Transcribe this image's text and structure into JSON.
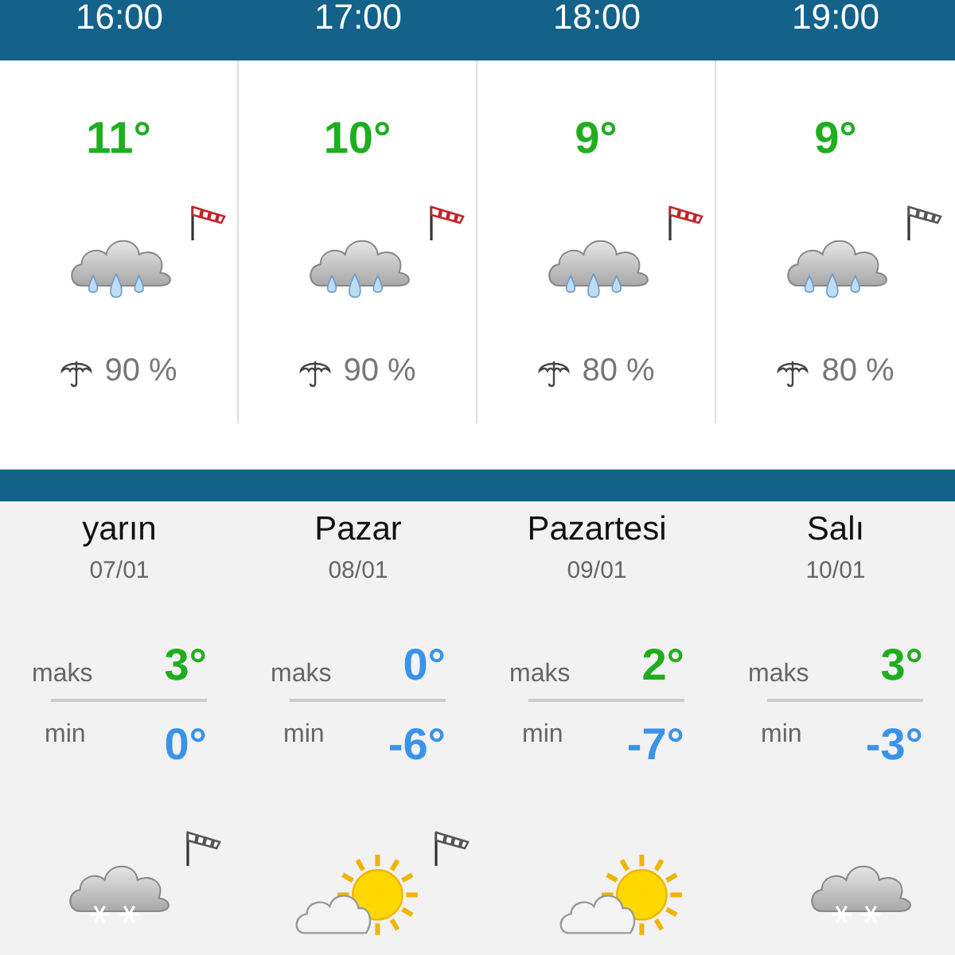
{
  "hourly": [
    {
      "time": "16:00",
      "temp": {
        "text": "11°",
        "color": "#1fae1f"
      },
      "kind": "rain",
      "windsock": {
        "color": "#c0262a"
      },
      "rain_chance": "90 %"
    },
    {
      "time": "17:00",
      "temp": {
        "text": "10°",
        "color": "#1fae1f"
      },
      "kind": "rain",
      "windsock": {
        "color": "#c0262a"
      },
      "rain_chance": "90 %"
    },
    {
      "time": "18:00",
      "temp": {
        "text": "9°",
        "color": "#1fae1f"
      },
      "kind": "rain",
      "windsock": {
        "color": "#c0262a"
      },
      "rain_chance": "80 %"
    },
    {
      "time": "19:00",
      "temp": {
        "text": "9°",
        "color": "#1fae1f"
      },
      "kind": "rain",
      "windsock": {
        "color": "#555555"
      },
      "rain_chance": "80 %"
    }
  ],
  "daily": [
    {
      "day": "yarın",
      "date": "07/01",
      "max_label": "maks",
      "max": {
        "text": "3°",
        "color": "#1fae1f"
      },
      "min_label": "min",
      "min": {
        "text": "0°",
        "color": "#3a93e8"
      },
      "kind": "snow",
      "windsock": {
        "color": "#555555"
      }
    },
    {
      "day": "Pazar",
      "date": "08/01",
      "max_label": "maks",
      "max": {
        "text": "0°",
        "color": "#3a93e8"
      },
      "min_label": "min",
      "min": {
        "text": "-6°",
        "color": "#3a93e8"
      },
      "kind": "sunny",
      "windsock": {
        "color": "#555555"
      }
    },
    {
      "day": "Pazartesi",
      "date": "09/01",
      "max_label": "maks",
      "max": {
        "text": "2°",
        "color": "#1fae1f"
      },
      "min_label": "min",
      "min": {
        "text": "-7°",
        "color": "#3a93e8"
      },
      "kind": "sunny"
    },
    {
      "day": "Salı",
      "date": "10/01",
      "max_label": "maks",
      "max": {
        "text": "3°",
        "color": "#1fae1f"
      },
      "min_label": "min",
      "min": {
        "text": "-3°",
        "color": "#3a93e8"
      },
      "kind": "snow"
    }
  ]
}
